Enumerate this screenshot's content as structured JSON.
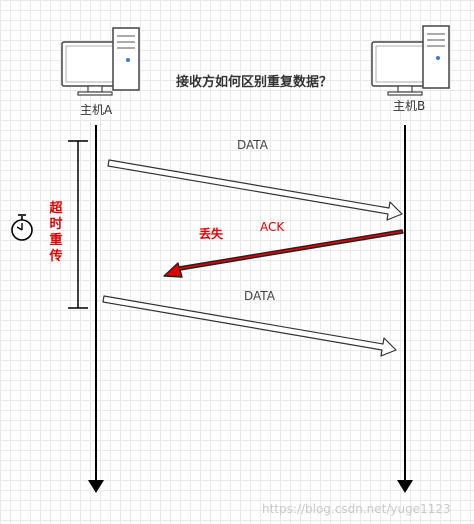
{
  "title": "接收方如何区别重复数据？",
  "hosts": {
    "a": "主机A",
    "b": "主机B"
  },
  "messages": {
    "data1": "DATA",
    "ack": "ACK",
    "data2": "DATA"
  },
  "lost_label": "丢失",
  "timeout_label": "超\n时\n重\n传",
  "watermark": "https://blog.csdn.net/yuge1123",
  "icons": {
    "computer": "computer-icon",
    "timer": "stopwatch-icon"
  },
  "colors": {
    "line": "#000000",
    "ack_arrow": "#e00000",
    "timeout_text": "#e00000"
  }
}
